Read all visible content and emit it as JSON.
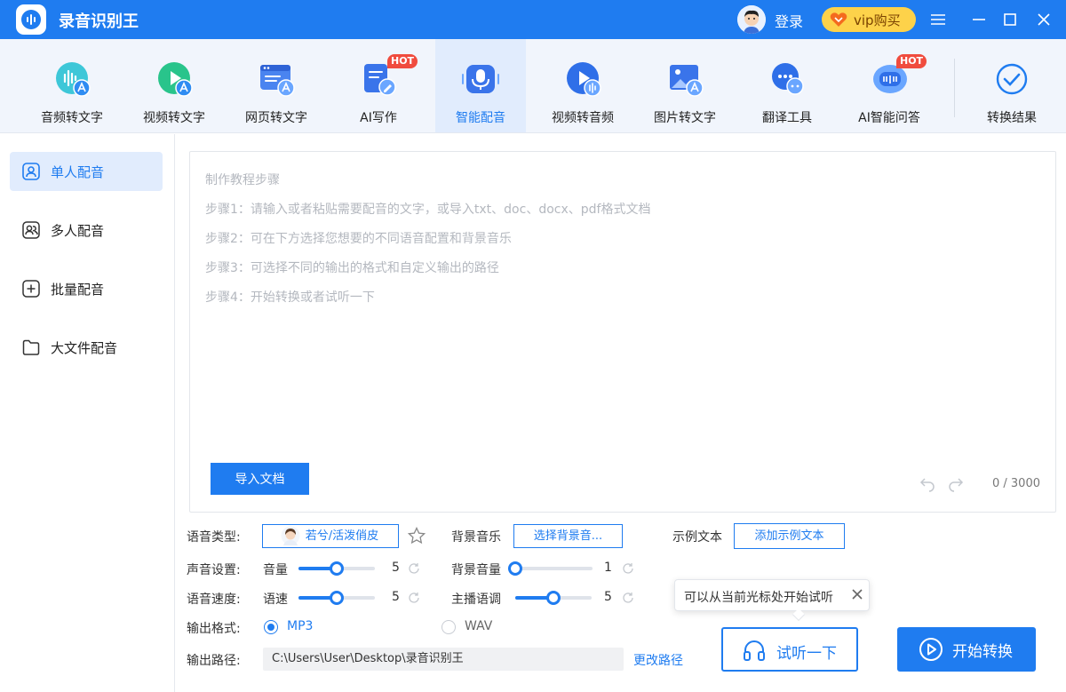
{
  "app": {
    "title": "录音识别王",
    "login": "登录",
    "vip": "vip购买"
  },
  "toolbar": {
    "items": [
      {
        "label": "音频转文字",
        "icon": "audio-to-text-icon",
        "hot": ""
      },
      {
        "label": "视频转文字",
        "icon": "video-to-text-icon",
        "hot": ""
      },
      {
        "label": "网页转文字",
        "icon": "webpage-to-text-icon",
        "hot": ""
      },
      {
        "label": "AI写作",
        "icon": "ai-writing-icon",
        "hot": "HOT"
      },
      {
        "label": "智能配音",
        "icon": "microphone-icon",
        "hot": ""
      },
      {
        "label": "视频转音频",
        "icon": "video-to-audio-icon",
        "hot": ""
      },
      {
        "label": "图片转文字",
        "icon": "image-to-text-icon",
        "hot": ""
      },
      {
        "label": "翻译工具",
        "icon": "translate-icon",
        "hot": ""
      },
      {
        "label": "AI智能问答",
        "icon": "ai-chat-icon",
        "hot": "HOT"
      }
    ],
    "results": "转换结果"
  },
  "sidebar": {
    "items": [
      {
        "label": "单人配音",
        "icon": "single-user-icon"
      },
      {
        "label": "多人配音",
        "icon": "multi-user-icon"
      },
      {
        "label": "批量配音",
        "icon": "batch-plus-icon"
      },
      {
        "label": "大文件配音",
        "icon": "folder-icon"
      }
    ]
  },
  "editor": {
    "tutorial": [
      "制作教程步骤",
      "步骤1：请输入或者粘贴需要配音的文字，或导入txt、doc、docx、pdf格式文档",
      "步骤2：可在下方选择您想要的不同语音配置和背景音乐",
      "步骤3：可选择不同的输出的格式和自定义输出的路径",
      "步骤4：开始转换或者试听一下"
    ],
    "import_button": "导入文档",
    "counter": "0 / 3000"
  },
  "settings": {
    "voice_type_label": "语音类型:",
    "voice_name": "若兮/活泼俏皮",
    "bg_music_label": "背景音乐",
    "bg_music_button": "选择背景音...",
    "sample_label": "示例文本",
    "sample_button": "添加示例文本",
    "sound_label": "声音设置:",
    "volume_label": "音量",
    "volume_value": "5",
    "volume_level": 0.5,
    "bg_volume_label": "背景音量",
    "bg_volume_value": "1",
    "bg_volume_level": 0.0,
    "speed_label": "语音速度:",
    "rate_label": "语速",
    "rate_value": "5",
    "rate_level": 0.5,
    "pitch_label": "主播语调",
    "pitch_value": "5",
    "pitch_level": 0.5,
    "format_label": "输出格式:",
    "format_mp3": "MP3",
    "format_wav": "WAV",
    "format_selected": "MP3",
    "path_label": "输出路径:",
    "path_value": "C:\\Users\\User\\Desktop\\录音识别王",
    "change_path": "更改路径"
  },
  "tooltip": "可以从当前光标处开始试听",
  "actions": {
    "listen": "试听一下",
    "start": "开始转换"
  },
  "colors": {
    "accent": "#1f7cf0",
    "vip": "#fdd24a",
    "hot": "#f04c3e"
  }
}
